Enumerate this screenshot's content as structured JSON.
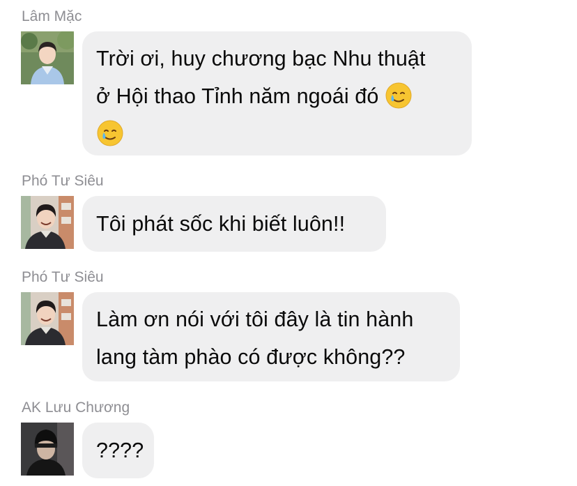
{
  "messages": [
    {
      "sender": "Lâm Mặc",
      "avatar_icon": "boy-in-blue-shirt-outdoors-avatar",
      "lines": [
        "Trời ơi, huy chương bạc Nhu thuật",
        "ở Hội thao Tỉnh năm ngoái đó",
        ""
      ],
      "emoji_icon": "crying-smile-emoji"
    },
    {
      "sender": "Phó Tư Siêu",
      "avatar_icon": "smiling-boy-avatar",
      "lines": [
        "Tôi phát sốc khi biết luôn!!"
      ]
    },
    {
      "sender": "Phó Tư Siêu",
      "avatar_icon": "smiling-boy-avatar",
      "lines": [
        "Làm ơn nói với tôi đây là tin hành",
        "lang tàm phào có được không??"
      ]
    },
    {
      "sender": "AK Lưu Chương",
      "avatar_icon": "boy-in-beanie-avatar",
      "lines": [
        "????"
      ]
    }
  ],
  "colors": {
    "bubble": "#efeff0",
    "sender_name": "#8e8e93",
    "text": "#0a0a0a"
  }
}
